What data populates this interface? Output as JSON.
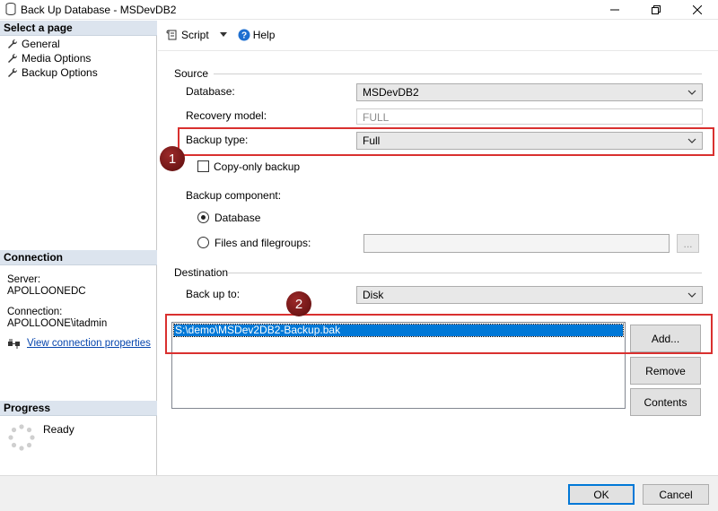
{
  "window": {
    "title": "Back Up Database - MSDevDB2"
  },
  "left": {
    "select_page_header": "Select a page",
    "pages": [
      "General",
      "Media Options",
      "Backup Options"
    ],
    "connection_header": "Connection",
    "server_label": "Server:",
    "server_value": "APOLLOONEDC",
    "connection_label": "Connection:",
    "connection_value": "APOLLOONE\\itadmin",
    "view_props_link": "View connection properties",
    "progress_header": "Progress",
    "progress_status": "Ready"
  },
  "toolbar": {
    "script_label": "Script",
    "help_label": "Help"
  },
  "source": {
    "header": "Source",
    "database_label": "Database:",
    "database_value": "MSDevDB2",
    "recovery_label": "Recovery model:",
    "recovery_value": "FULL",
    "backup_type_label": "Backup type:",
    "backup_type_value": "Full",
    "copy_only_label": "Copy-only backup",
    "component_label": "Backup component:",
    "component_database": "Database",
    "component_files": "Files and filegroups:",
    "browse_label": "..."
  },
  "destination": {
    "header": "Destination",
    "backup_to_label": "Back up to:",
    "backup_to_value": "Disk",
    "files": [
      "S:\\demo\\MSDev2DB2-Backup.bak"
    ],
    "add_label": "Add...",
    "remove_label": "Remove",
    "contents_label": "Contents"
  },
  "callouts": {
    "one": "1",
    "two": "2"
  },
  "footer": {
    "ok_label": "OK",
    "cancel_label": "Cancel"
  },
  "colors": {
    "callout": "#d9302f",
    "badge": "#7a1616",
    "selection": "#0078d7",
    "section_header": "#dce4ee"
  }
}
